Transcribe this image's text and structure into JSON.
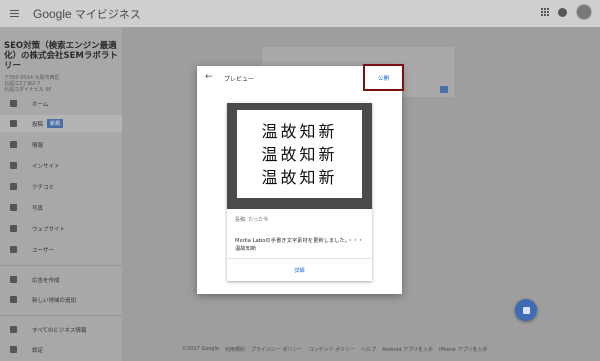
{
  "header": {
    "brand_google": "Google",
    "brand_product": "マイビジネス"
  },
  "sidebar": {
    "business_name": "SEO対策（検索エンジン最適化）の株式会社SEMラボラトリー",
    "address_lines": [
      "〒550-0014 大阪市西区",
      "北堀江2丁目2-7",
      "北堀江ダイナビル 6F"
    ],
    "items": [
      {
        "label": "ホーム",
        "icon": "home-icon"
      },
      {
        "label": "投稿",
        "icon": "posts-icon",
        "badge": "新規"
      },
      {
        "label": "情報",
        "icon": "info-icon"
      },
      {
        "label": "インサイト",
        "icon": "insights-icon"
      },
      {
        "label": "クチコミ",
        "icon": "star-icon"
      },
      {
        "label": "写真",
        "icon": "photos-icon"
      },
      {
        "label": "ウェブサイト",
        "icon": "website-icon"
      },
      {
        "label": "ユーザー",
        "icon": "users-icon"
      },
      {
        "label": "広告を作成",
        "icon": "ads-icon"
      },
      {
        "label": "新しい地域の追加",
        "icon": "location-icon"
      },
      {
        "label": "すべてのビジネス情報",
        "icon": "all-businesses-icon"
      },
      {
        "label": "設定",
        "icon": "settings-icon"
      }
    ]
  },
  "dialog": {
    "title": "プレビュー",
    "publish_label": "公開",
    "image_lines": [
      "温故知新",
      "温故知新",
      "温故知新"
    ],
    "post_meta": "投稿: たった今",
    "post_body": "Media Laboの手書き文字素材を更新しました。・・・温故知新",
    "details_label": "詳細"
  },
  "footer": {
    "links": [
      "©2017 Google",
      "利用規約",
      "プライバシー ポリシー",
      "コンテンツ ポリシー",
      "ヘルプ",
      "Android アプリを入手",
      "iPhone アプリを入手"
    ]
  },
  "colors": {
    "highlight_border": "#7a1010",
    "link_blue": "#1a66d6",
    "fab_blue": "#3f6ab4"
  }
}
